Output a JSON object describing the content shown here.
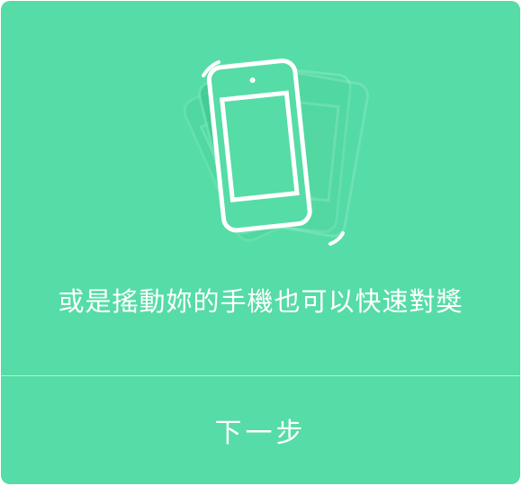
{
  "colors": {
    "background": "#56dca6",
    "foreground": "#ffffff",
    "phone_shadow": "#3fc88f"
  },
  "illustration": {
    "icon": "shake-phone-icon"
  },
  "dialog": {
    "message": "或是搖動妳的手機也可以快速對獎",
    "next_label": "下一步"
  }
}
